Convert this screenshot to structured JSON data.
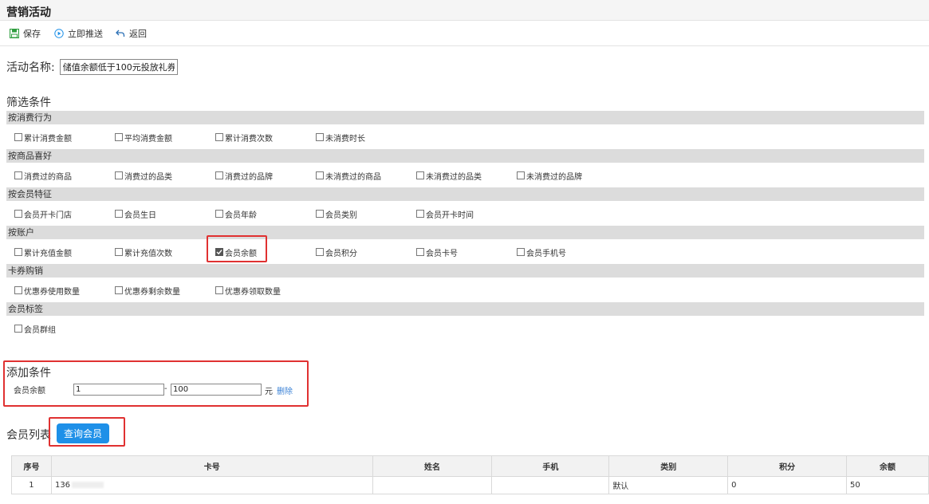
{
  "header": {
    "title": "营销活动"
  },
  "toolbar": {
    "save": "保存",
    "push": "立即推送",
    "back": "返回"
  },
  "activity": {
    "label": "活动名称:",
    "value": "储值余额低于100元投放礼券"
  },
  "filter": {
    "title": "筛选条件",
    "groups": [
      {
        "label": "按消费行为",
        "items": [
          "累计消费金额",
          "平均消费金额",
          "累计消费次数",
          "未消费时长"
        ]
      },
      {
        "label": "按商品喜好",
        "items": [
          "消费过的商品",
          "消费过的品类",
          "消费过的品牌",
          "未消费过的商品",
          "未消费过的品类",
          "未消费过的品牌"
        ]
      },
      {
        "label": "按会员特征",
        "items": [
          "会员开卡门店",
          "会员生日",
          "会员年龄",
          "会员类别",
          "会员开卡时间"
        ]
      },
      {
        "label": "按账户",
        "items": [
          "累计充值金额",
          "累计充值次数",
          "会员余额",
          "会员积分",
          "会员卡号",
          "会员手机号"
        ],
        "checked_index": 2
      },
      {
        "label": "卡券购销",
        "items": [
          "优惠券使用数量",
          "优惠券剩余数量",
          "优惠券领取数量"
        ]
      },
      {
        "label": "会员标签",
        "items": [
          "会员群组"
        ]
      }
    ]
  },
  "add_condition": {
    "title": "添加条件",
    "label": "会员余额",
    "min": "1",
    "separator": "-",
    "max": "100",
    "unit": "元",
    "delete": "删除"
  },
  "members": {
    "title": "会员列表",
    "query_button": "查询会员",
    "columns": [
      "序号",
      "卡号",
      "姓名",
      "手机",
      "类别",
      "积分",
      "余额"
    ],
    "rows": [
      {
        "index": "1",
        "card": "136",
        "name": "",
        "phone": "",
        "category": "默认",
        "points": "0",
        "balance": "50"
      }
    ]
  },
  "colors": {
    "accent": "#1e90e8",
    "highlight": "#e03131",
    "link": "#3b82d6"
  }
}
